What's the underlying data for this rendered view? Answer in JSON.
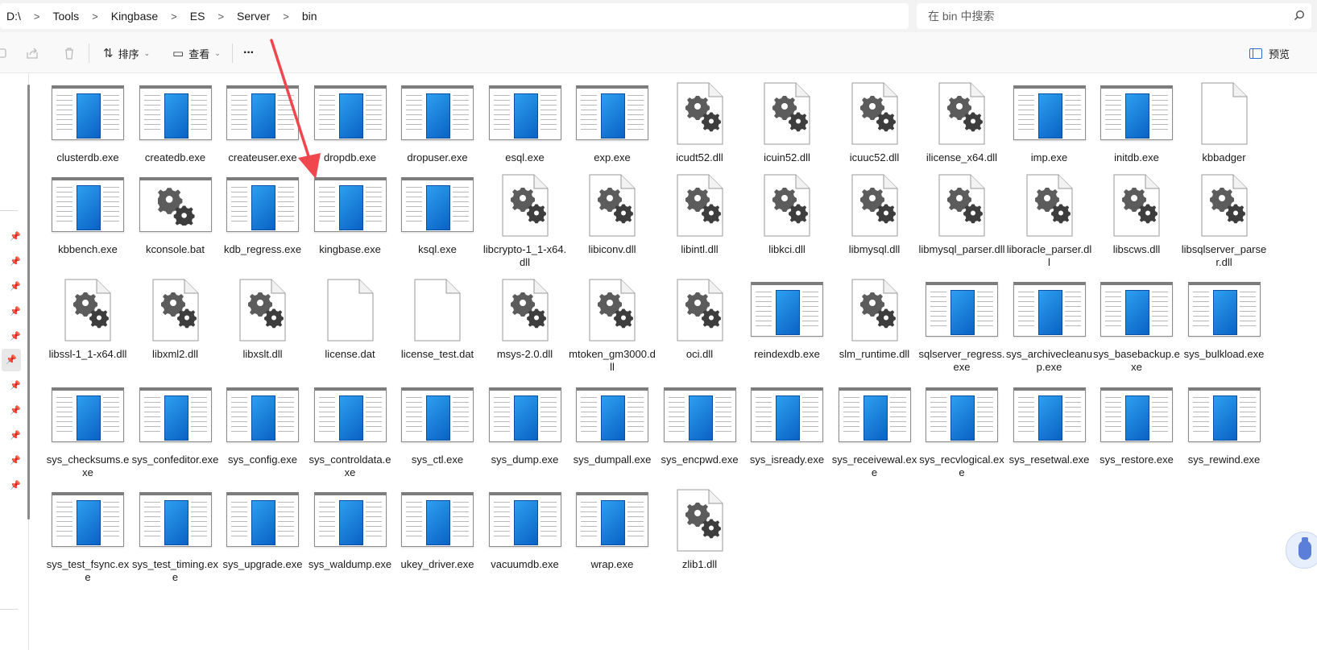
{
  "breadcrumb": [
    "D:\\",
    "Tools",
    "Kingbase",
    "ES",
    "Server",
    "bin"
  ],
  "search": {
    "placeholder": "在 bin 中搜索"
  },
  "toolbar": {
    "sort": "排序",
    "view": "查看",
    "more": "···",
    "preview": "预览"
  },
  "files": [
    {
      "name": "clusterdb.exe",
      "type": "exe"
    },
    {
      "name": "createdb.exe",
      "type": "exe"
    },
    {
      "name": "createuser.exe",
      "type": "exe"
    },
    {
      "name": "dropdb.exe",
      "type": "exe"
    },
    {
      "name": "dropuser.exe",
      "type": "exe"
    },
    {
      "name": "esql.exe",
      "type": "exe"
    },
    {
      "name": "exp.exe",
      "type": "exe"
    },
    {
      "name": "icudt52.dll",
      "type": "dll"
    },
    {
      "name": "icuin52.dll",
      "type": "dll"
    },
    {
      "name": "icuuc52.dll",
      "type": "dll"
    },
    {
      "name": "ilicense_x64.dll",
      "type": "dll"
    },
    {
      "name": "imp.exe",
      "type": "exe"
    },
    {
      "name": "initdb.exe",
      "type": "exe"
    },
    {
      "name": "kbbadger",
      "type": "blank"
    },
    {
      "name": "kbbench.exe",
      "type": "exe"
    },
    {
      "name": "kconsole.bat",
      "type": "bat"
    },
    {
      "name": "kdb_regress.exe",
      "type": "exe"
    },
    {
      "name": "kingbase.exe",
      "type": "exe"
    },
    {
      "name": "ksql.exe",
      "type": "exe"
    },
    {
      "name": "libcrypto-1_1-x64.dll",
      "type": "dll"
    },
    {
      "name": "libiconv.dll",
      "type": "dll"
    },
    {
      "name": "libintl.dll",
      "type": "dll"
    },
    {
      "name": "libkci.dll",
      "type": "dll"
    },
    {
      "name": "libmysql.dll",
      "type": "dll"
    },
    {
      "name": "libmysql_parser.dll",
      "type": "dll"
    },
    {
      "name": "liboracle_parser.dll",
      "type": "dll"
    },
    {
      "name": "libscws.dll",
      "type": "dll"
    },
    {
      "name": "libsqlserver_parser.dll",
      "type": "dll"
    },
    {
      "name": "libssl-1_1-x64.dll",
      "type": "dll"
    },
    {
      "name": "libxml2.dll",
      "type": "dll"
    },
    {
      "name": "libxslt.dll",
      "type": "dll"
    },
    {
      "name": "license.dat",
      "type": "blank"
    },
    {
      "name": "license_test.dat",
      "type": "blank"
    },
    {
      "name": "msys-2.0.dll",
      "type": "dll"
    },
    {
      "name": "mtoken_gm3000.dll",
      "type": "dll"
    },
    {
      "name": "oci.dll",
      "type": "dll"
    },
    {
      "name": "reindexdb.exe",
      "type": "exe"
    },
    {
      "name": "slm_runtime.dll",
      "type": "dll"
    },
    {
      "name": "sqlserver_regress.exe",
      "type": "exe"
    },
    {
      "name": "sys_archivecleanup.exe",
      "type": "exe"
    },
    {
      "name": "sys_basebackup.exe",
      "type": "exe"
    },
    {
      "name": "sys_bulkload.exe",
      "type": "exe"
    },
    {
      "name": "sys_checksums.exe",
      "type": "exe"
    },
    {
      "name": "sys_confeditor.exe",
      "type": "exe"
    },
    {
      "name": "sys_config.exe",
      "type": "exe"
    },
    {
      "name": "sys_controldata.exe",
      "type": "exe"
    },
    {
      "name": "sys_ctl.exe",
      "type": "exe"
    },
    {
      "name": "sys_dump.exe",
      "type": "exe"
    },
    {
      "name": "sys_dumpall.exe",
      "type": "exe"
    },
    {
      "name": "sys_encpwd.exe",
      "type": "exe"
    },
    {
      "name": "sys_isready.exe",
      "type": "exe"
    },
    {
      "name": "sys_receivewal.exe",
      "type": "exe"
    },
    {
      "name": "sys_recvlogical.exe",
      "type": "exe"
    },
    {
      "name": "sys_resetwal.exe",
      "type": "exe"
    },
    {
      "name": "sys_restore.exe",
      "type": "exe"
    },
    {
      "name": "sys_rewind.exe",
      "type": "exe"
    },
    {
      "name": "sys_test_fsync.exe",
      "type": "exe"
    },
    {
      "name": "sys_test_timing.exe",
      "type": "exe"
    },
    {
      "name": "sys_upgrade.exe",
      "type": "exe"
    },
    {
      "name": "sys_waldump.exe",
      "type": "exe"
    },
    {
      "name": "ukey_driver.exe",
      "type": "exe"
    },
    {
      "name": "vacuumdb.exe",
      "type": "exe"
    },
    {
      "name": "wrap.exe",
      "type": "exe"
    },
    {
      "name": "zlib1.dll",
      "type": "dll"
    }
  ],
  "colors": {
    "accent": "#2b6fd6",
    "arrow": "#f0474f"
  }
}
